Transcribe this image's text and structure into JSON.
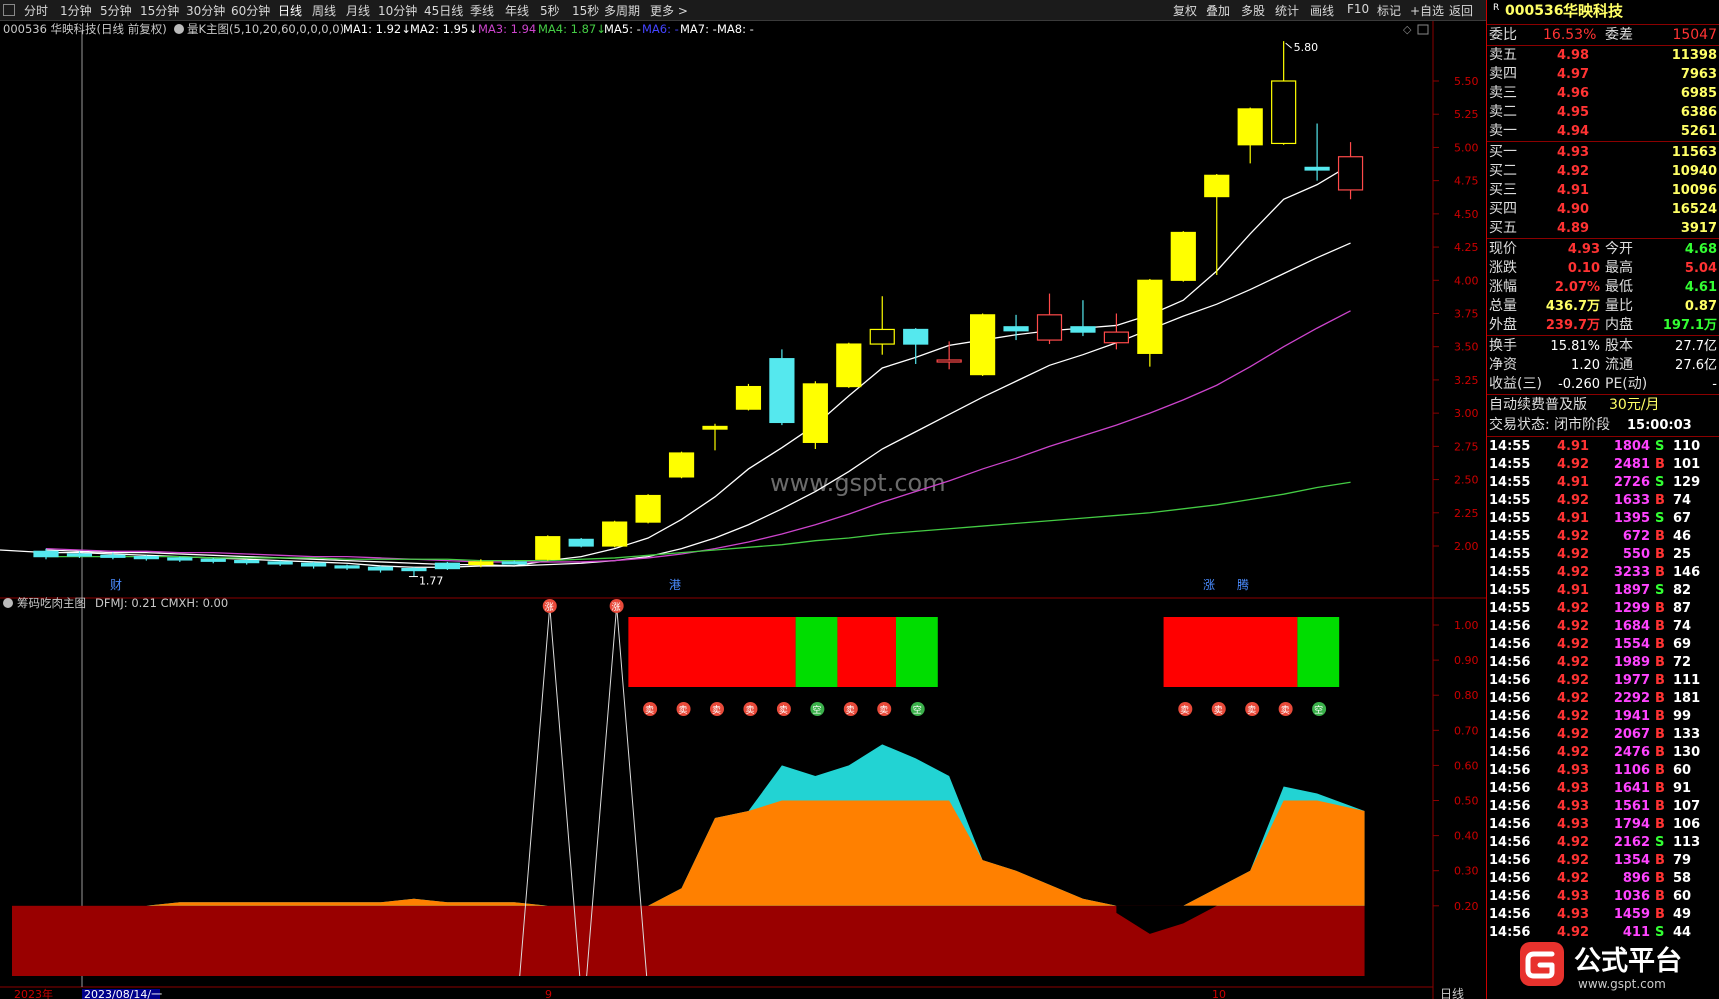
{
  "toolbar": {
    "periods": [
      "分时",
      "1分钟",
      "5分钟",
      "15分钟",
      "30分钟",
      "60分钟",
      "日线",
      "周线",
      "月线",
      "10分钟",
      "45日线",
      "季线",
      "年线",
      "5秒",
      "15秒",
      "多周期",
      "更多 >"
    ],
    "active": "日线",
    "right_tools": [
      "复权",
      "叠加",
      "多股",
      "统计",
      "画线",
      "F10",
      "标记",
      "+自选",
      "返回"
    ]
  },
  "chart": {
    "stock_label": "000536 华映科技(日线 前复权)",
    "indicator_name": "量K主图(5,10,20,60,0,0,0,0)",
    "ma_items": [
      {
        "label": "MA1: 1.92",
        "arrow": "↓",
        "color": "#ffffff"
      },
      {
        "label": "MA2: 1.95",
        "arrow": "↓",
        "color": "#ffffff"
      },
      {
        "label": "MA3: 1.94",
        "arrow": "",
        "color": "#cc44cc"
      },
      {
        "label": "MA4: 1.87",
        "arrow": "↓",
        "color": "#44cc44"
      },
      {
        "label": "MA5: -",
        "arrow": "",
        "color": "#ffffff"
      },
      {
        "label": "MA6: -",
        "arrow": "",
        "color": "#4444ff"
      },
      {
        "label": "MA7: -",
        "arrow": "",
        "color": "#ffffff"
      },
      {
        "label": "MA8: -",
        "arrow": "",
        "color": "#ffffff"
      }
    ],
    "high_label": "5.80",
    "low_label": "1.77",
    "watermark": "www.gspt.com",
    "markers": [
      "财",
      "港",
      "涨",
      "腾"
    ],
    "price_axis": [
      "5.50",
      "5.25",
      "5.00",
      "4.75",
      "4.50",
      "4.25",
      "4.00",
      "3.75",
      "3.50",
      "3.25",
      "3.00",
      "2.75",
      "2.50",
      "2.25",
      "2.00"
    ],
    "lower_title": "筹码吃肉主图",
    "lower_values": "DFMJ: 0.21  CMXH: 0.00",
    "lower_axis": [
      "1.00",
      "0.90",
      "0.80",
      "0.70",
      "0.60",
      "0.50",
      "0.40",
      "0.30",
      "0.20"
    ],
    "date_year": "2023年",
    "date_cursor": "2023/08/14/一",
    "month_labels": [
      "9",
      "10"
    ],
    "period_label": "日线",
    "badge_mai": "卖",
    "badge_zhang": "涨",
    "badge_kong": "空",
    "badge_duo": "多",
    "colors": {
      "up": "#ffff00",
      "down": "#55e8ee",
      "red": "#ff0000",
      "green": "#00dd00",
      "orange": "#ff8000",
      "cyan": "#22d3d3",
      "darkred": "#990000"
    }
  },
  "chart_data": {
    "type": "candlestick",
    "title": "000536 华映科技(日线 前复权)",
    "ylim": [
      1.7,
      5.9
    ],
    "candles": [
      {
        "o": 1.96,
        "c": 1.92,
        "h": 1.98,
        "l": 1.9
      },
      {
        "o": 1.94,
        "c": 1.93,
        "h": 1.96,
        "l": 1.91
      },
      {
        "o": 1.93,
        "c": 1.92,
        "h": 1.95,
        "l": 1.9
      },
      {
        "o": 1.92,
        "c": 1.91,
        "h": 1.93,
        "l": 1.89
      },
      {
        "o": 1.91,
        "c": 1.9,
        "h": 1.92,
        "l": 1.88
      },
      {
        "o": 1.9,
        "c": 1.89,
        "h": 1.91,
        "l": 1.87
      },
      {
        "o": 1.89,
        "c": 1.88,
        "h": 1.9,
        "l": 1.86
      },
      {
        "o": 1.88,
        "c": 1.87,
        "h": 1.89,
        "l": 1.85
      },
      {
        "o": 1.87,
        "c": 1.85,
        "h": 1.88,
        "l": 1.83
      },
      {
        "o": 1.85,
        "c": 1.84,
        "h": 1.86,
        "l": 1.82
      },
      {
        "o": 1.84,
        "c": 1.82,
        "h": 1.85,
        "l": 1.8
      },
      {
        "o": 1.83,
        "c": 1.82,
        "h": 1.84,
        "l": 1.77
      },
      {
        "o": 1.87,
        "c": 1.83,
        "h": 1.88,
        "l": 1.82
      },
      {
        "o": 1.86,
        "c": 1.88,
        "h": 1.9,
        "l": 1.84
      },
      {
        "o": 1.88,
        "c": 1.87,
        "h": 1.89,
        "l": 1.86
      },
      {
        "o": 1.9,
        "c": 2.07,
        "h": 2.08,
        "l": 1.89
      },
      {
        "o": 2.05,
        "c": 2.0,
        "h": 2.06,
        "l": 1.99
      },
      {
        "o": 2.0,
        "c": 2.18,
        "h": 2.19,
        "l": 1.99
      },
      {
        "o": 2.18,
        "c": 2.38,
        "h": 2.39,
        "l": 2.17
      },
      {
        "o": 2.52,
        "c": 2.7,
        "h": 2.71,
        "l": 2.51
      },
      {
        "o": 2.88,
        "c": 2.9,
        "h": 2.92,
        "l": 2.72
      },
      {
        "o": 3.03,
        "c": 3.2,
        "h": 3.22,
        "l": 3.02
      },
      {
        "o": 3.41,
        "c": 2.93,
        "h": 3.48,
        "l": 2.91
      },
      {
        "o": 2.78,
        "c": 3.22,
        "h": 3.24,
        "l": 2.73
      },
      {
        "o": 3.2,
        "c": 3.52,
        "h": 3.53,
        "l": 3.19
      },
      {
        "o": 3.52,
        "c": 3.63,
        "h": 3.88,
        "l": 3.44
      },
      {
        "o": 3.63,
        "c": 3.52,
        "h": 3.64,
        "l": 3.37
      },
      {
        "o": 3.39,
        "c": 3.4,
        "h": 3.54,
        "l": 3.33
      },
      {
        "o": 3.29,
        "c": 3.74,
        "h": 3.75,
        "l": 3.28
      },
      {
        "o": 3.65,
        "c": 3.62,
        "h": 3.74,
        "l": 3.55
      },
      {
        "o": 3.55,
        "c": 3.74,
        "h": 3.9,
        "l": 3.52
      },
      {
        "o": 3.65,
        "c": 3.61,
        "h": 3.85,
        "l": 3.58
      },
      {
        "o": 3.53,
        "c": 3.61,
        "h": 3.75,
        "l": 3.48
      },
      {
        "o": 3.45,
        "c": 4.0,
        "h": 4.01,
        "l": 3.35
      },
      {
        "o": 4.0,
        "c": 4.36,
        "h": 4.37,
        "l": 3.99
      },
      {
        "o": 4.63,
        "c": 4.79,
        "h": 4.8,
        "l": 4.04
      },
      {
        "o": 5.02,
        "c": 5.29,
        "h": 5.3,
        "l": 4.88
      },
      {
        "o": 5.03,
        "c": 5.5,
        "h": 5.8,
        "l": 5.02
      },
      {
        "o": 4.85,
        "c": 4.83,
        "h": 5.18,
        "l": 4.75
      },
      {
        "o": 4.68,
        "c": 4.93,
        "h": 5.04,
        "l": 4.61
      }
    ],
    "ma": [
      {
        "name": "MA1",
        "color": "#ffffff",
        "values": [
          1.95,
          1.95,
          1.94,
          1.93,
          1.92,
          1.91,
          1.9,
          1.89,
          1.88,
          1.87,
          1.85,
          1.84,
          1.84,
          1.85,
          1.85,
          1.89,
          1.92,
          1.98,
          2.06,
          2.2,
          2.37,
          2.58,
          2.74,
          2.91,
          3.13,
          3.34,
          3.42,
          3.51,
          3.55,
          3.59,
          3.62,
          3.64,
          3.66,
          3.74,
          3.85,
          4.07,
          4.35,
          4.61,
          4.72,
          4.87
        ]
      },
      {
        "name": "MA2",
        "color": "#ffffff",
        "values": [
          1.97,
          1.96,
          1.95,
          1.95,
          1.94,
          1.93,
          1.92,
          1.91,
          1.9,
          1.89,
          1.88,
          1.87,
          1.86,
          1.86,
          1.85,
          1.86,
          1.87,
          1.89,
          1.92,
          1.98,
          2.06,
          2.16,
          2.28,
          2.41,
          2.56,
          2.73,
          2.86,
          2.99,
          3.12,
          3.24,
          3.36,
          3.44,
          3.53,
          3.63,
          3.73,
          3.82,
          3.93,
          4.05,
          4.17,
          4.28
        ]
      },
      {
        "name": "MA3",
        "color": "#cc44cc",
        "values": [
          1.98,
          1.97,
          1.96,
          1.96,
          1.95,
          1.95,
          1.94,
          1.93,
          1.92,
          1.92,
          1.91,
          1.9,
          1.89,
          1.88,
          1.88,
          1.88,
          1.88,
          1.89,
          1.91,
          1.94,
          1.98,
          2.03,
          2.09,
          2.16,
          2.24,
          2.33,
          2.41,
          2.49,
          2.58,
          2.66,
          2.75,
          2.83,
          2.91,
          3.0,
          3.1,
          3.21,
          3.35,
          3.5,
          3.64,
          3.77
        ]
      },
      {
        "name": "MA4",
        "color": "#44cc44",
        "values": [
          1.92,
          1.92,
          1.92,
          1.92,
          1.92,
          1.91,
          1.91,
          1.91,
          1.91,
          1.9,
          1.9,
          1.9,
          1.9,
          1.89,
          1.89,
          1.89,
          1.9,
          1.91,
          1.93,
          1.95,
          1.97,
          1.99,
          2.01,
          2.04,
          2.06,
          2.09,
          2.11,
          2.13,
          2.15,
          2.17,
          2.19,
          2.21,
          2.23,
          2.25,
          2.28,
          2.31,
          2.35,
          2.39,
          2.44,
          2.48
        ]
      }
    ],
    "dfmj_orange": [
      0.2,
      0.2,
      0.2,
      0.2,
      0.21,
      0.21,
      0.21,
      0.21,
      0.21,
      0.21,
      0.21,
      0.22,
      0.21,
      0.21,
      0.21,
      0.2,
      0.2,
      0.19,
      0.2,
      0.25,
      0.45,
      0.47,
      0.5,
      0.5,
      0.5,
      0.5,
      0.5,
      0.5,
      0.33,
      0.3,
      0.26,
      0.22,
      0.18,
      0.12,
      0.15,
      0.25,
      0.3,
      0.5,
      0.5,
      0.47
    ],
    "dfmj_cyan": [
      0,
      0,
      0,
      0,
      0,
      0,
      0,
      0,
      0,
      0,
      0,
      0,
      0,
      0,
      0,
      0,
      0,
      0,
      0,
      0,
      0,
      0,
      0.6,
      0.57,
      0.6,
      0.66,
      0.62,
      0.57,
      0,
      0,
      0,
      0,
      0,
      0,
      0,
      0,
      0,
      0.54,
      0.52,
      0
    ],
    "base_band": 0.2,
    "cmxh_spikes": [
      15,
      17
    ],
    "signal_blocks": [
      {
        "from": 17.5,
        "to": 22.5,
        "state": "red"
      },
      {
        "from": 22.5,
        "to": 23.75,
        "state": "green"
      },
      {
        "from": 23.75,
        "to": 25.5,
        "state": "red"
      },
      {
        "from": 25.5,
        "to": 26.75,
        "state": "green"
      },
      {
        "from": 33.5,
        "to": 37.5,
        "state": "red"
      },
      {
        "from": 37.5,
        "to": 38.75,
        "state": "green"
      }
    ],
    "badges": [
      {
        "i": 18,
        "t": "mai"
      },
      {
        "i": 19,
        "t": "mai"
      },
      {
        "i": 20,
        "t": "mai"
      },
      {
        "i": 21,
        "t": "mai"
      },
      {
        "i": 22,
        "t": "mai"
      },
      {
        "i": 23,
        "t": "kong"
      },
      {
        "i": 24,
        "t": "mai"
      },
      {
        "i": 25,
        "t": "mai"
      },
      {
        "i": 26,
        "t": "kong"
      },
      {
        "i": 34,
        "t": "mai"
      },
      {
        "i": 35,
        "t": "mai"
      },
      {
        "i": 36,
        "t": "mai"
      },
      {
        "i": 37,
        "t": "mai"
      },
      {
        "i": 38,
        "t": "kong"
      }
    ]
  },
  "panel": {
    "flag": "R",
    "code": "000536",
    "name": "华映科技",
    "order_ratio_label": "委比",
    "order_ratio": "16.53%",
    "order_diff_label": "委差",
    "order_diff": "15047",
    "asks": [
      {
        "label": "卖五",
        "price": "4.98",
        "vol": "11398"
      },
      {
        "label": "卖四",
        "price": "4.97",
        "vol": "7963"
      },
      {
        "label": "卖三",
        "price": "4.96",
        "vol": "6985"
      },
      {
        "label": "卖二",
        "price": "4.95",
        "vol": "6386"
      },
      {
        "label": "卖一",
        "price": "4.94",
        "vol": "5261"
      }
    ],
    "bids": [
      {
        "label": "买一",
        "price": "4.93",
        "vol": "11563"
      },
      {
        "label": "买二",
        "price": "4.92",
        "vol": "10940"
      },
      {
        "label": "买三",
        "price": "4.91",
        "vol": "10096"
      },
      {
        "label": "买四",
        "price": "4.90",
        "vol": "16524"
      },
      {
        "label": "买五",
        "price": "4.89",
        "vol": "3917"
      }
    ],
    "quote": [
      {
        "l1": "现价",
        "v1": "4.93",
        "c1": "#ff3333",
        "l2": "今开",
        "v2": "4.68",
        "c2": "#33ff33"
      },
      {
        "l1": "涨跌",
        "v1": "0.10",
        "c1": "#ff3333",
        "l2": "最高",
        "v2": "5.04",
        "c2": "#ff3333"
      },
      {
        "l1": "涨幅",
        "v1": "2.07%",
        "c1": "#ff3333",
        "l2": "最低",
        "v2": "4.61",
        "c2": "#33ff33"
      },
      {
        "l1": "总量",
        "v1": "436.7万",
        "c1": "#ffff66",
        "l2": "量比",
        "v2": "0.87",
        "c2": "#ffff66"
      },
      {
        "l1": "外盘",
        "v1": "239.7万",
        "c1": "#ff3333",
        "l2": "内盘",
        "v2": "197.1万",
        "c2": "#33ff33"
      }
    ],
    "fund": [
      {
        "l1": "换手",
        "v1": "15.81%",
        "l2": "股本",
        "v2": "27.7亿"
      },
      {
        "l1": "净资",
        "v1": "1.20",
        "l2": "流通",
        "v2": "27.6亿"
      },
      {
        "l1": "收益(三)",
        "v1": "-0.260",
        "l2": "PE(动)",
        "v2": "-"
      }
    ],
    "promo_label": "自动续费普及版",
    "promo_price": "30元/月",
    "status_label": "交易状态: 闭市阶段",
    "status_time": "15:00:03",
    "ticks": [
      {
        "t": "14:55",
        "p": "4.91",
        "v": "1804",
        "s": "S",
        "n": "110"
      },
      {
        "t": "14:55",
        "p": "4.92",
        "v": "2481",
        "s": "B",
        "n": "101"
      },
      {
        "t": "14:55",
        "p": "4.91",
        "v": "2726",
        "s": "S",
        "n": "129"
      },
      {
        "t": "14:55",
        "p": "4.92",
        "v": "1633",
        "s": "B",
        "n": "74"
      },
      {
        "t": "14:55",
        "p": "4.91",
        "v": "1395",
        "s": "S",
        "n": "67"
      },
      {
        "t": "14:55",
        "p": "4.92",
        "v": "672",
        "s": "B",
        "n": "46"
      },
      {
        "t": "14:55",
        "p": "4.92",
        "v": "550",
        "s": "B",
        "n": "25"
      },
      {
        "t": "14:55",
        "p": "4.92",
        "v": "3233",
        "s": "B",
        "n": "146"
      },
      {
        "t": "14:55",
        "p": "4.91",
        "v": "1897",
        "s": "S",
        "n": "82"
      },
      {
        "t": "14:55",
        "p": "4.92",
        "v": "1299",
        "s": "B",
        "n": "87"
      },
      {
        "t": "14:56",
        "p": "4.92",
        "v": "1684",
        "s": "B",
        "n": "74"
      },
      {
        "t": "14:56",
        "p": "4.92",
        "v": "1554",
        "s": "B",
        "n": "69"
      },
      {
        "t": "14:56",
        "p": "4.92",
        "v": "1989",
        "s": "B",
        "n": "72"
      },
      {
        "t": "14:56",
        "p": "4.92",
        "v": "1977",
        "s": "B",
        "n": "111"
      },
      {
        "t": "14:56",
        "p": "4.92",
        "v": "2292",
        "s": "B",
        "n": "181"
      },
      {
        "t": "14:56",
        "p": "4.92",
        "v": "1941",
        "s": "B",
        "n": "99"
      },
      {
        "t": "14:56",
        "p": "4.92",
        "v": "2067",
        "s": "B",
        "n": "133"
      },
      {
        "t": "14:56",
        "p": "4.92",
        "v": "2476",
        "s": "B",
        "n": "130"
      },
      {
        "t": "14:56",
        "p": "4.93",
        "v": "1106",
        "s": "B",
        "n": "60"
      },
      {
        "t": "14:56",
        "p": "4.93",
        "v": "1641",
        "s": "B",
        "n": "91"
      },
      {
        "t": "14:56",
        "p": "4.93",
        "v": "1561",
        "s": "B",
        "n": "107"
      },
      {
        "t": "14:56",
        "p": "4.93",
        "v": "1794",
        "s": "B",
        "n": "106"
      },
      {
        "t": "14:56",
        "p": "4.92",
        "v": "2162",
        "s": "S",
        "n": "113"
      },
      {
        "t": "14:56",
        "p": "4.92",
        "v": "1354",
        "s": "B",
        "n": "79"
      },
      {
        "t": "14:56",
        "p": "4.92",
        "v": "896",
        "s": "B",
        "n": "58"
      },
      {
        "t": "14:56",
        "p": "4.93",
        "v": "1036",
        "s": "B",
        "n": "60"
      },
      {
        "t": "14:56",
        "p": "4.93",
        "v": "1459",
        "s": "B",
        "n": "49"
      },
      {
        "t": "14:56",
        "p": "4.92",
        "v": "411",
        "s": "S",
        "n": "44"
      }
    ]
  },
  "logo": {
    "text": "公式平台",
    "url": "www.gspt.com"
  }
}
